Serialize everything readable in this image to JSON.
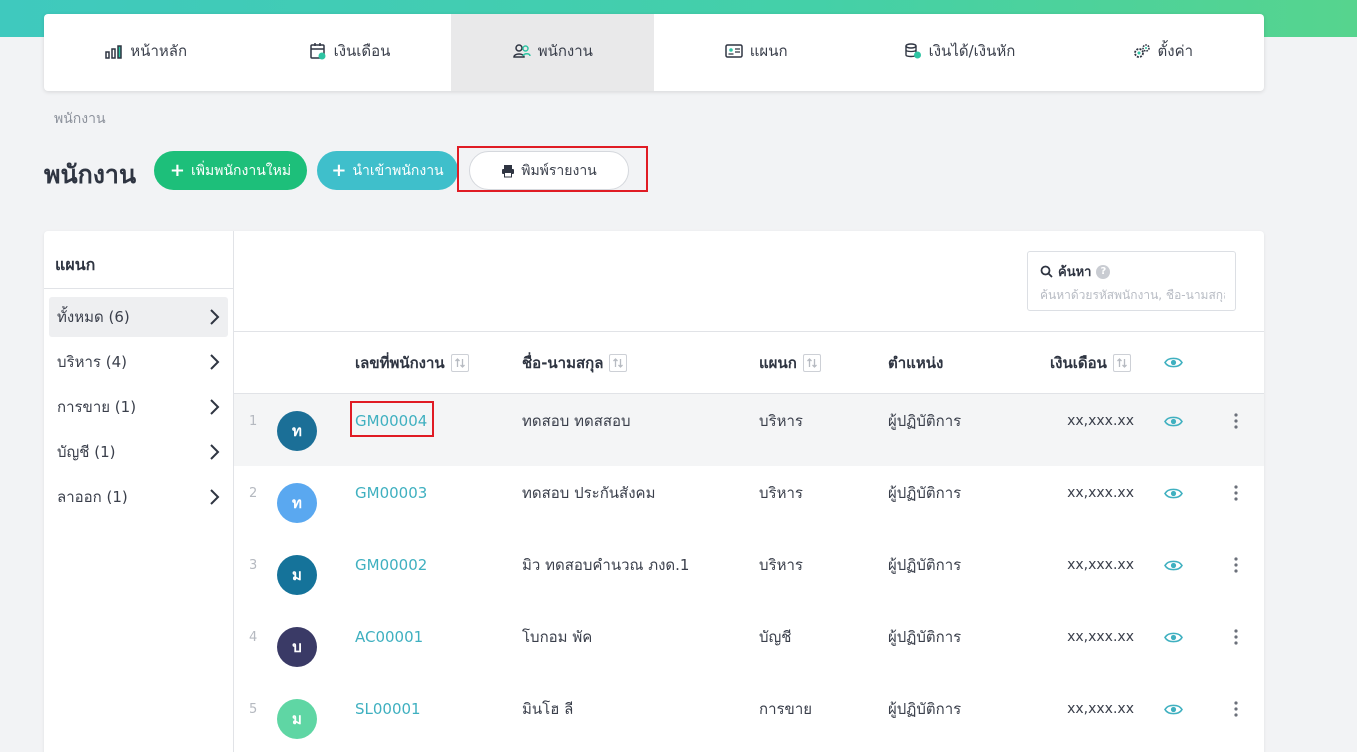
{
  "nav": {
    "items": [
      {
        "label": "หน้าหลัก",
        "icon": "bar-chart-icon"
      },
      {
        "label": "เงินเดือน",
        "icon": "calendar-icon"
      },
      {
        "label": "พนักงาน",
        "icon": "users-icon"
      },
      {
        "label": "แผนก",
        "icon": "id-card-icon"
      },
      {
        "label": "เงินได้/เงินหัก",
        "icon": "coins-icon"
      },
      {
        "label": "ตั้งค่า",
        "icon": "gears-icon"
      }
    ],
    "active": "พนักงาน"
  },
  "breadcrumb": "พนักงาน",
  "page_title": "พนักงาน",
  "actions": {
    "add_label": "เพิ่มพนักงานใหม่",
    "import_label": "นำเข้าพนักงาน",
    "print_label": "พิมพ์รายงาน"
  },
  "sidebar": {
    "title": "แผนก",
    "items": [
      {
        "label": "ทั้งหมด (6)"
      },
      {
        "label": "บริหาร (4)"
      },
      {
        "label": "การขาย (1)"
      },
      {
        "label": "บัญชี (1)"
      },
      {
        "label": "ลาออก (1)"
      }
    ]
  },
  "search": {
    "label": "ค้นหา",
    "help": "?",
    "placeholder": "ค้นหาด้วยรหัสพนักงาน, ชื่อ-นามสกุล"
  },
  "table": {
    "headers": {
      "id": "เลขที่พนักงาน",
      "name": "ชื่อ-นามสกุล",
      "dept": "แผนก",
      "position": "ตำแหน่ง",
      "salary": "เงินเดือน"
    },
    "rows": [
      {
        "index": "1",
        "initial": "ท",
        "avatar_color": "#1b6f97",
        "id": "GM00004",
        "name": "ทดสอบ ทดสสอบ",
        "dept": "บริหาร",
        "position": "ผู้ปฏิบัติการ",
        "salary": "xx,xxx.xx"
      },
      {
        "index": "2",
        "initial": "ท",
        "avatar_color": "#5aa8f0",
        "id": "GM00003",
        "name": "ทดสอบ ประกันสังคม",
        "dept": "บริหาร",
        "position": "ผู้ปฏิบัติการ",
        "salary": "xx,xxx.xx"
      },
      {
        "index": "3",
        "initial": "ม",
        "avatar_color": "#15739a",
        "id": "GM00002",
        "name": "มิว ทดสอบคำนวณ ภงด.1",
        "dept": "บริหาร",
        "position": "ผู้ปฏิบัติการ",
        "salary": "xx,xxx.xx"
      },
      {
        "index": "4",
        "initial": "บ",
        "avatar_color": "#3a3a66",
        "id": "AC00001",
        "name": "โบกอม พัค",
        "dept": "บัญชี",
        "position": "ผู้ปฏิบัติการ",
        "salary": "xx,xxx.xx"
      },
      {
        "index": "5",
        "initial": "ม",
        "avatar_color": "#5fd6a4",
        "id": "SL00001",
        "name": "มินโฮ ลี",
        "dept": "การขาย",
        "position": "ผู้ปฏิบัติการ",
        "salary": "xx,xxx.xx"
      }
    ]
  },
  "colors": {
    "accent_green": "#1dbf7a",
    "accent_teal": "#3fbfcb",
    "link": "#3fb0c0",
    "highlight_red": "#e01b24"
  }
}
